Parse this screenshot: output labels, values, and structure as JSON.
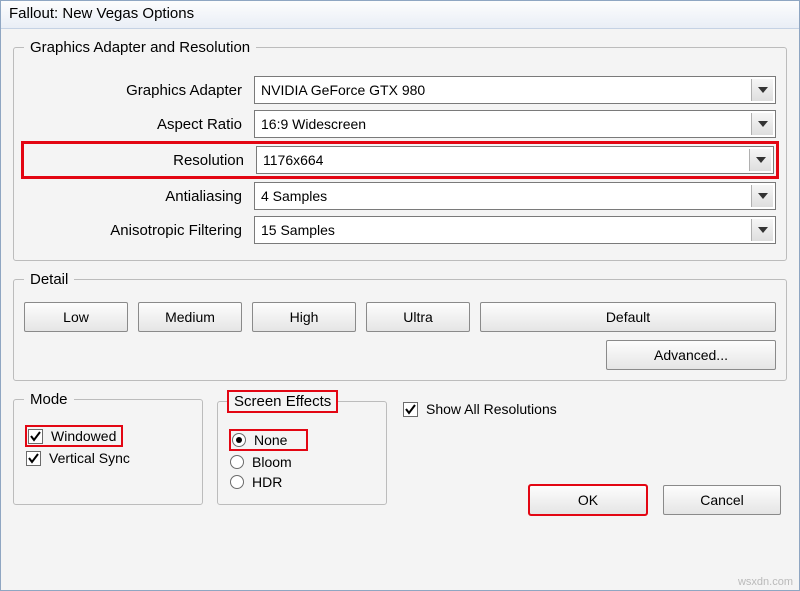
{
  "window": {
    "title": "Fallout: New Vegas Options"
  },
  "groups": {
    "graphics": {
      "legend": "Graphics Adapter and Resolution",
      "adapter": {
        "label": "Graphics Adapter",
        "value": "NVIDIA GeForce GTX 980"
      },
      "aspect": {
        "label": "Aspect Ratio",
        "value": "16:9 Widescreen"
      },
      "resolution": {
        "label": "Resolution",
        "value": "1176x664"
      },
      "aa": {
        "label": "Antialiasing",
        "value": "4 Samples"
      },
      "aniso": {
        "label": "Anisotropic Filtering",
        "value": "15 Samples"
      }
    },
    "detail": {
      "legend": "Detail",
      "low": "Low",
      "medium": "Medium",
      "high": "High",
      "ultra": "Ultra",
      "default": "Default",
      "advanced": "Advanced..."
    },
    "mode": {
      "legend": "Mode",
      "windowed": {
        "label": "Windowed",
        "checked": true
      },
      "vsync": {
        "label": "Vertical Sync",
        "checked": true
      }
    },
    "effects": {
      "legend": "Screen Effects",
      "none": {
        "label": "None",
        "selected": true
      },
      "bloom": {
        "label": "Bloom",
        "selected": false
      },
      "hdr": {
        "label": "HDR",
        "selected": false
      }
    }
  },
  "showAllResolutions": {
    "label": "Show All Resolutions",
    "checked": true
  },
  "buttons": {
    "ok": "OK",
    "cancel": "Cancel"
  },
  "watermark": "wsxdn.com"
}
